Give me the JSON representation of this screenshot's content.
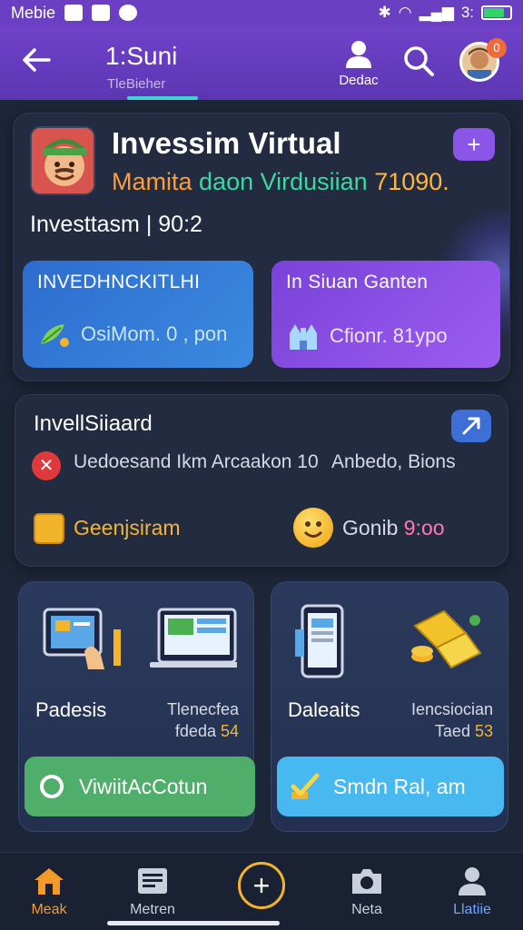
{
  "status_bar": {
    "carrier": "Mebie",
    "time": "3:",
    "battery": ""
  },
  "header": {
    "title": "1:Suni",
    "subtitle": "TleBieher",
    "profile_label": "Dedac",
    "notification_count": "0"
  },
  "invest": {
    "title": "Invessim Virtual",
    "sub_a": "Mamita",
    "sub_b": "daon Virdusiian",
    "sub_c": "71090.",
    "plus_label": "+",
    "total": "Investtasm | 90:2",
    "tile_left": {
      "title": "INVEDHNCKITLHI",
      "value": "OsiMom. 0 , pon"
    },
    "tile_right": {
      "title": "In Siuan Ganten",
      "value": "Cfionr. 81ypo"
    }
  },
  "board": {
    "title": "InvellSiiaard",
    "desc": "Uedoesand Ikm Arcaakon 10",
    "right": "Anbedo, Bions",
    "gen": "Geenjsiram",
    "rank_prefix": "Gonib ",
    "rank_value": "9:oo"
  },
  "products": [
    {
      "name": "Padesis",
      "meta_top": "Tlenecfea",
      "meta_label": "fdeda ",
      "meta_num": "54",
      "button": "ViwiitAcCotun"
    },
    {
      "name": "Daleaits",
      "meta_top": "Iencsiocian",
      "meta_label": "Taed ",
      "meta_num": "53",
      "button": "Smdn Ral, am"
    }
  ],
  "nav": {
    "items": [
      {
        "label": "Meak"
      },
      {
        "label": "Metren"
      },
      {
        "label": "Neta"
      },
      {
        "label": "Llatiie"
      }
    ]
  },
  "colors": {
    "header": "#6a3fc2",
    "background": "#1d2538",
    "accent_orange": "#f39a2a",
    "green_button": "#4fae6a",
    "cyan_button": "#48b8f0"
  }
}
